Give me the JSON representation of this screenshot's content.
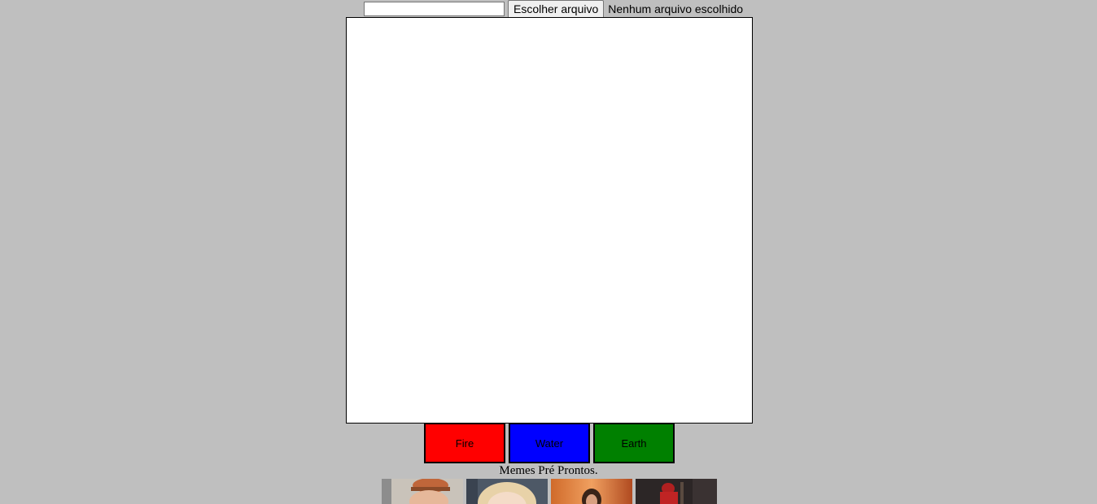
{
  "file_picker": {
    "text_value": "",
    "choose_label": "Escolher arquivo",
    "status": "Nenhum arquivo escolhido"
  },
  "buttons": [
    {
      "label": "Fire",
      "color": "#ff0000"
    },
    {
      "label": "Water",
      "color": "#0000ff"
    },
    {
      "label": "Earth",
      "color": "#008000"
    }
  ],
  "memes_caption": "Memes Pré Prontos.",
  "thumbnails": [
    "meme-thumbnail",
    "meme-thumbnail",
    "meme-thumbnail",
    "meme-thumbnail"
  ]
}
